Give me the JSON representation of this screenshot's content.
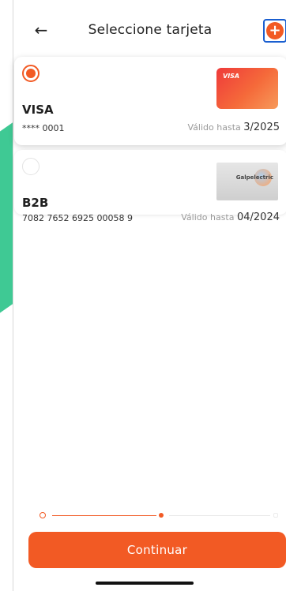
{
  "header": {
    "title": "Seleccione tarjeta",
    "back_icon": "arrow-left-icon",
    "add_icon": "plus-circle-icon"
  },
  "cards": [
    {
      "name": "VISA",
      "number": "**** 0001",
      "expiry_label": "Válido hasta",
      "expiry_value": "3/2025",
      "brand_text": "VISA",
      "selected": true
    },
    {
      "name": "B2B",
      "number": "7082 7652 6925 00058 9",
      "expiry_label": "Válido hasta",
      "expiry_value": "04/2024",
      "brand_text": "Galpelectric",
      "selected": false
    }
  ],
  "stepper": {
    "current_step": 2,
    "total_steps": 3
  },
  "footer": {
    "continue_label": "Continuar"
  },
  "colors": {
    "accent": "#f25a24",
    "background_shape": "#3fc994",
    "highlight_border": "#1a5fd0"
  }
}
